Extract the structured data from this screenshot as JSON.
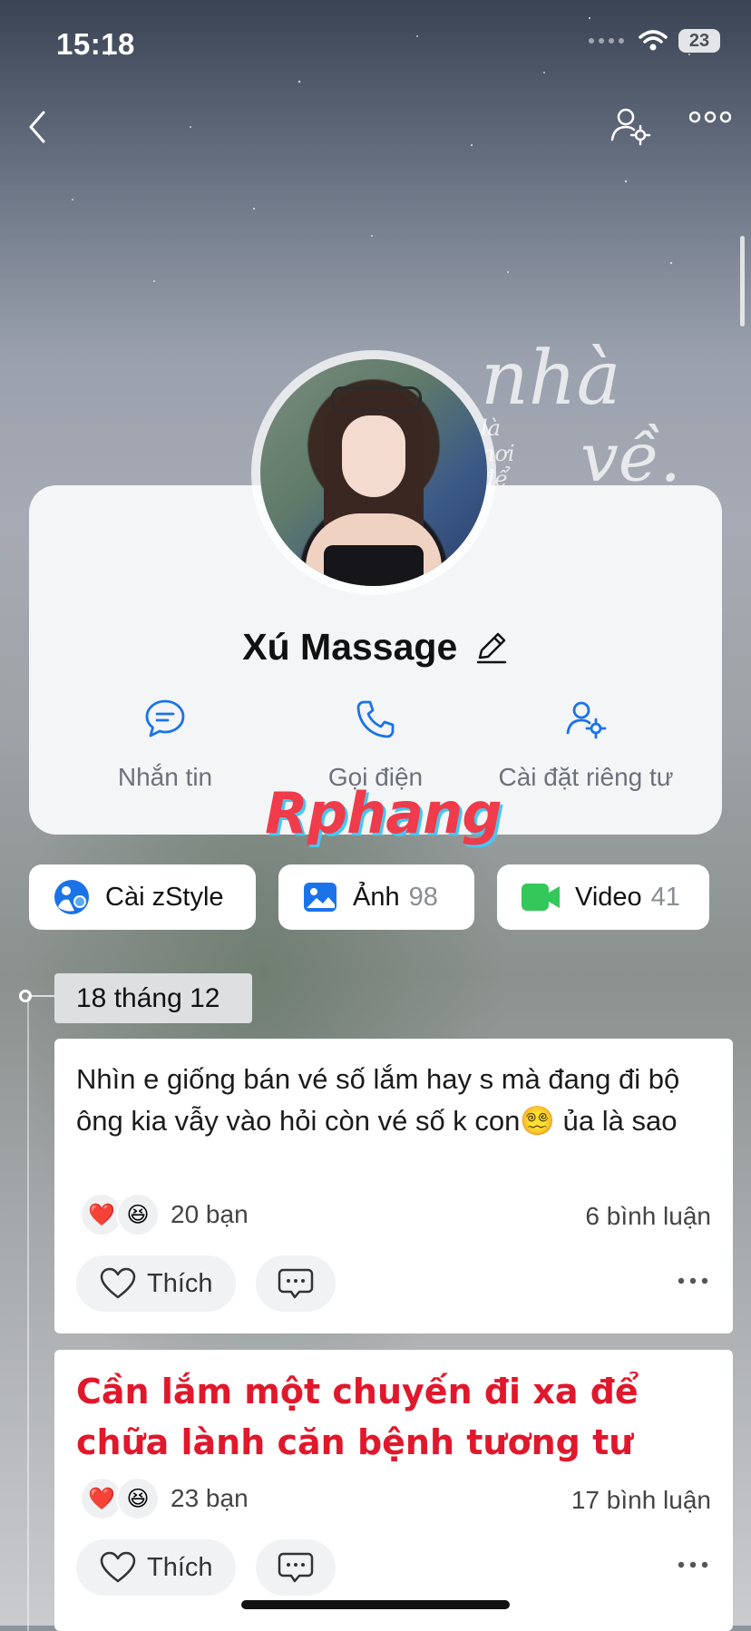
{
  "status_bar": {
    "time": "15:18",
    "battery": "23"
  },
  "profile": {
    "name": "Xú Massage",
    "actions": [
      {
        "label": "Nhắn tin",
        "icon": "chat-bubble-icon"
      },
      {
        "label": "Gọi điện",
        "icon": "phone-icon"
      },
      {
        "label": "Cài đặt riêng tư",
        "icon": "user-settings-icon"
      }
    ]
  },
  "cover": {
    "script_line1": "nhà",
    "script_line2": "là nơi để",
    "script_line3": "về."
  },
  "watermark": "Rphang",
  "chips": [
    {
      "label": "Cài zStyle",
      "count": ""
    },
    {
      "label": "Ảnh",
      "count": "98"
    },
    {
      "label": "Video",
      "count": "41"
    }
  ],
  "timeline": {
    "date": "18 tháng 12"
  },
  "posts": [
    {
      "text": "Nhìn e giống bán vé số lắm hay s mà đang đi bộ ông kia vẫy vào hỏi còn vé số k con😵‍💫 ủa là sao",
      "reactions_count": "20 bạn",
      "comments": "6 bình luận",
      "like_label": "Thích"
    },
    {
      "text": "Cần lắm một chuyến đi xa để chữa lành căn bệnh tương tư",
      "reactions_count": "23 bạn",
      "comments": "17 bình luận",
      "like_label": "Thích"
    }
  ],
  "colors": {
    "accent": "#1a73e8",
    "red_text": "#e0182c",
    "video_green": "#34c759"
  }
}
